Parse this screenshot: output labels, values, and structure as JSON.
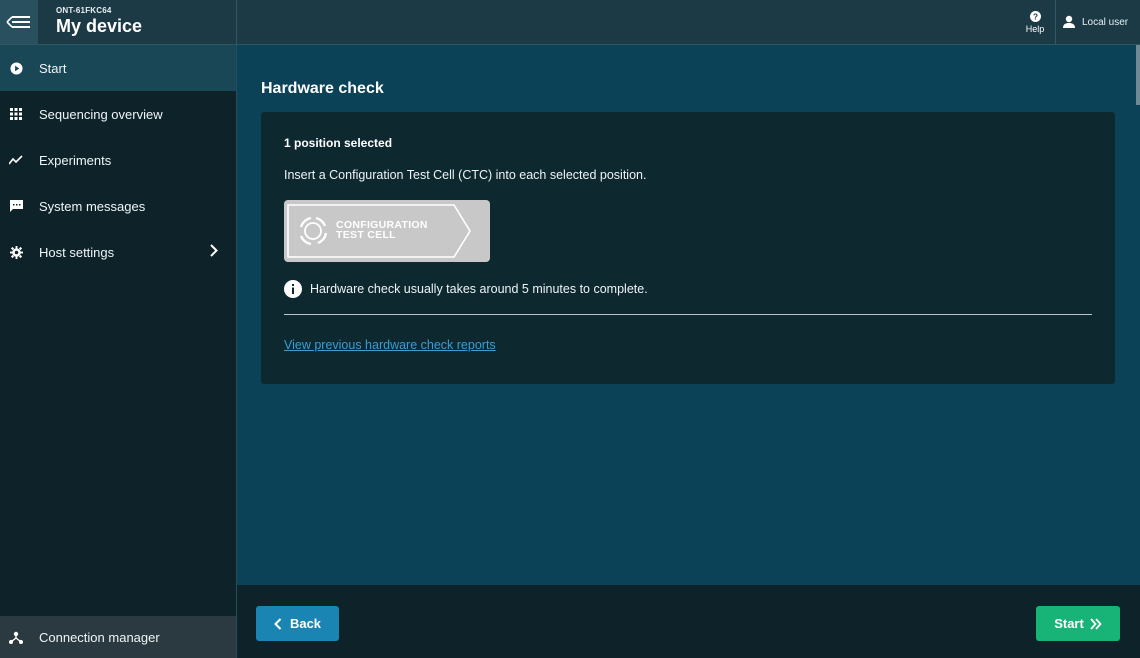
{
  "header": {
    "device_id": "ONT-61FKC64",
    "device_name": "My device",
    "help_label": "Help",
    "user_label": "Local user"
  },
  "sidebar": {
    "items": [
      {
        "label": "Start",
        "icon": "play-circle-icon",
        "active": true
      },
      {
        "label": "Sequencing overview",
        "icon": "grid-icon"
      },
      {
        "label": "Experiments",
        "icon": "trend-line-icon"
      },
      {
        "label": "System messages",
        "icon": "chat-icon"
      },
      {
        "label": "Host settings",
        "icon": "gear-icon"
      }
    ],
    "connection_manager": "Connection manager"
  },
  "main": {
    "title": "Hardware check",
    "positions_selected": "1 position selected",
    "instruction": "Insert a Configuration Test Cell (CTC) into each selected position.",
    "ctc_image": {
      "line1": "CONFIGURATION",
      "line2": "TEST CELL"
    },
    "info_text": "Hardware check usually takes around 5 minutes to complete.",
    "reports_link": "View previous hardware check reports"
  },
  "footer": {
    "back_label": "Back",
    "start_label": "Start"
  },
  "colors": {
    "accent_blue": "#1a85b3",
    "start_green": "#18b377",
    "link": "#3a9fcf"
  }
}
